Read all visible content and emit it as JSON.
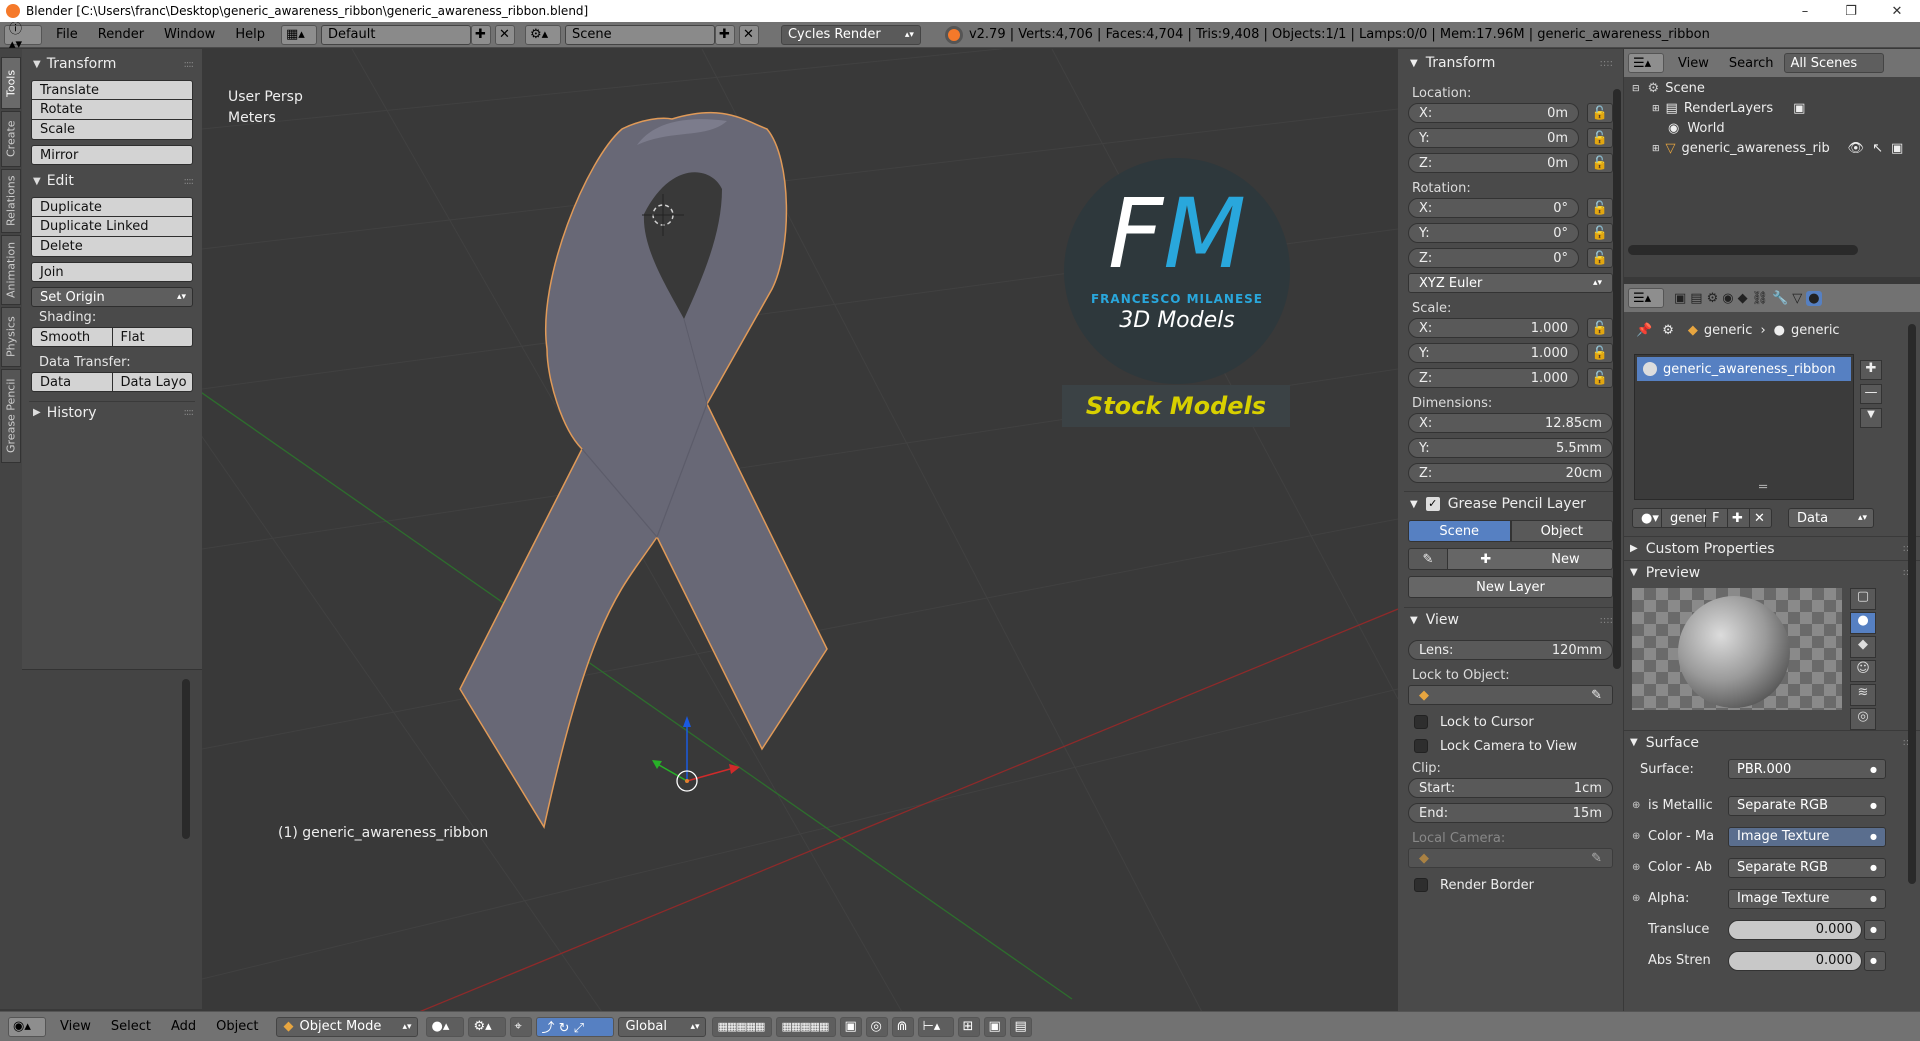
{
  "window": {
    "title": "Blender [C:\\Users\\franc\\Desktop\\generic_awareness_ribbon\\generic_awareness_ribbon.blend]",
    "minimize": "–",
    "maximize": "❐",
    "close": "✕"
  },
  "header": {
    "menus": [
      "File",
      "Render",
      "Window",
      "Help"
    ],
    "layout": "Default",
    "scene": "Scene",
    "engine": "Cycles Render",
    "stats": "v2.79 | Verts:4,706 | Faces:4,704 | Tris:9,408 | Objects:1/1 | Lamps:0/0 | Mem:17.96M | generic_awareness_ribbon"
  },
  "left_tabs": [
    "Tools",
    "Create",
    "Relations",
    "Animation",
    "Physics",
    "Grease Pencil"
  ],
  "toolshelf": {
    "transform_title": "Transform",
    "translate": "Translate",
    "rotate": "Rotate",
    "scale": "Scale",
    "mirror": "Mirror",
    "edit_title": "Edit",
    "duplicate": "Duplicate",
    "duplicate_linked": "Duplicate Linked",
    "delete": "Delete",
    "join": "Join",
    "set_origin": "Set Origin",
    "shading_label": "Shading:",
    "smooth": "Smooth",
    "flat": "Flat",
    "data_transfer_label": "Data Transfer:",
    "data": "Data",
    "data_layout": "Data Layo",
    "history_title": "History"
  },
  "viewport": {
    "view_name": "User Persp",
    "units": "Meters",
    "object_label": "(1) generic_awareness_ribbon",
    "watermark_fm": "FM",
    "watermark_name": "FRANCESCO MILANESE",
    "watermark_sub": "3D Models",
    "watermark_stock": "Stock Models"
  },
  "npanel": {
    "transform_title": "Transform",
    "location_label": "Location:",
    "location": {
      "x": "0m",
      "y": "0m",
      "z": "0m"
    },
    "rotation_label": "Rotation:",
    "rotation": {
      "x": "0°",
      "y": "0°",
      "z": "0°"
    },
    "rotation_mode": "XYZ Euler",
    "scale_label": "Scale:",
    "scale": {
      "x": "1.000",
      "y": "1.000",
      "z": "1.000"
    },
    "dimensions_label": "Dimensions:",
    "dimensions": {
      "x": "12.85cm",
      "y": "5.5mm",
      "z": "20cm"
    },
    "x_key": "X:",
    "y_key": "Y:",
    "z_key": "Z:",
    "grease_title": "Grease Pencil Layer",
    "scene_tab": "Scene",
    "object_tab": "Object",
    "new": "New",
    "new_layer": "New Layer",
    "view_title": "View",
    "lens_key": "Lens:",
    "lens": "120mm",
    "lock_to_object": "Lock to Object:",
    "lock_to_cursor": "Lock to Cursor",
    "lock_camera": "Lock Camera to View",
    "clip_label": "Clip:",
    "start_key": "Start:",
    "clip_start": "1cm",
    "end_key": "End:",
    "clip_end": "15m",
    "local_camera": "Local Camera:",
    "render_border": "Render Border"
  },
  "outliner": {
    "view": "View",
    "search": "Search",
    "filter": "All Scenes",
    "items": [
      "Scene",
      "RenderLayers",
      "World",
      "generic_awareness_rib"
    ]
  },
  "properties": {
    "crumb1": "generic",
    "crumb2": "generic",
    "material_slot": "generic_awareness_ribbon",
    "mat_name": "gener",
    "mat_f": "F",
    "data": "Data",
    "custom_properties": "Custom Properties",
    "preview": "Preview",
    "surface_title": "Surface",
    "surface_key": "Surface:",
    "surface_val": "PBR.000",
    "inputs": [
      {
        "key": "is Metallic",
        "val": "Separate RGB"
      },
      {
        "key": "Color - Ma",
        "val": "Image Texture"
      },
      {
        "key": "Color - Ab",
        "val": "Separate RGB"
      },
      {
        "key": "Alpha:",
        "val": "Image Texture"
      }
    ],
    "translucent_key": "Transluce",
    "translucent_val": "0.000",
    "abs_key": "Abs Stren",
    "abs_val": "0.000"
  },
  "bottombar": {
    "menus": [
      "View",
      "Select",
      "Add",
      "Object"
    ],
    "mode": "Object Mode",
    "orientation": "Global"
  }
}
